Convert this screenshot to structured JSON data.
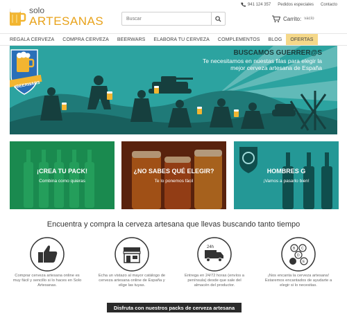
{
  "brand": {
    "line1": "solo",
    "line2": "ARTESANAS",
    "accent_color": "#e8a21a"
  },
  "toplinks": {
    "phone": "941 124 357",
    "special_orders": "Pedidos especiales",
    "contact": "Contacto"
  },
  "search": {
    "placeholder": "Buscar",
    "icon": "search-icon"
  },
  "cart": {
    "label": "Carrito:",
    "status": "vacío",
    "icon": "cart-icon"
  },
  "nav": {
    "items": [
      {
        "label": "REGALA CERVEZA"
      },
      {
        "label": "COMPRA CERVEZA"
      },
      {
        "label": "BEERWARS"
      },
      {
        "label": "ELABORA TU CERVEZA"
      },
      {
        "label": "COMPLEMENTOS"
      },
      {
        "label": "BLOG"
      },
      {
        "label": "OFERTAS",
        "active": true
      }
    ]
  },
  "hero": {
    "title": "BUSCAMOS GUERRER@S",
    "subtitle": "Te necesitamos en nuestas filas para elegir la mejor cerveza artesana de España",
    "badge": "#BEERWARS",
    "bg_color": "#2ca3a0"
  },
  "tiles": [
    {
      "title": "¡CREA TU PACK!",
      "subtitle": "Combina como quieras",
      "color": "#1f9a58"
    },
    {
      "title": "¿NO SABES QUÉ ELEGIR?",
      "subtitle": "Te lo ponemos fácil",
      "color": "#c2541e"
    },
    {
      "title": "HOMBRES G",
      "subtitle": "¡Vamos a pasarlo bien!",
      "color": "#2aa8a6"
    }
  ],
  "features": {
    "heading": "Encuentra y compra la cerveza artesana que llevas buscando tanto tiempo",
    "items": [
      {
        "icon": "thumbs-up-icon",
        "text": "Comprar cerveza artesana online es muy fácil y sencillo si lo haces en Solo Artesanas."
      },
      {
        "icon": "store-icon",
        "text": "Echa un vistazo al mayor catálogo de cerveza artesana online de España y elige las tuyas."
      },
      {
        "icon": "delivery-truck-icon",
        "text": "Entrega en 24/72 horas (envíos a península) desde que sale del almacén del productor."
      },
      {
        "icon": "beer-tasting-icon",
        "text": "¡Nos encanta la cerveza artesana! Estaremos encantados de ayudarte a elegir si lo necesitas."
      }
    ]
  },
  "packs_banner": "Disfruta con nuestros packs de cerveza artesana"
}
